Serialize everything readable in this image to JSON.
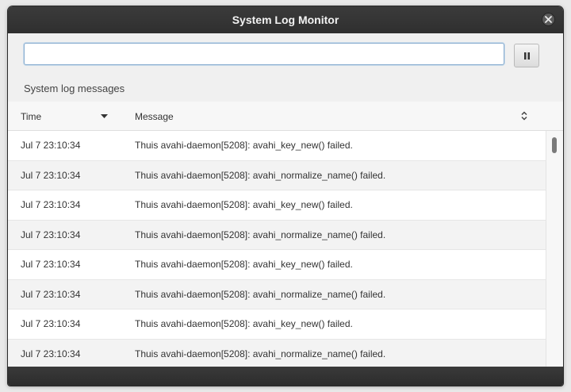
{
  "window": {
    "title": "System Log Monitor"
  },
  "toolbar": {
    "search_value": "",
    "pause_icon": "pause-icon"
  },
  "section": {
    "label": "System log messages"
  },
  "table": {
    "columns": {
      "time": "Time",
      "message": "Message"
    },
    "rows": [
      {
        "time": "Jul 7 23:10:34",
        "message": "Thuis avahi-daemon[5208]: avahi_key_new() failed."
      },
      {
        "time": "Jul 7 23:10:34",
        "message": "Thuis avahi-daemon[5208]: avahi_normalize_name() failed."
      },
      {
        "time": "Jul 7 23:10:34",
        "message": "Thuis avahi-daemon[5208]: avahi_key_new() failed."
      },
      {
        "time": "Jul 7 23:10:34",
        "message": "Thuis avahi-daemon[5208]: avahi_normalize_name() failed."
      },
      {
        "time": "Jul 7 23:10:34",
        "message": "Thuis avahi-daemon[5208]: avahi_key_new() failed."
      },
      {
        "time": "Jul 7 23:10:34",
        "message": "Thuis avahi-daemon[5208]: avahi_normalize_name() failed."
      },
      {
        "time": "Jul 7 23:10:34",
        "message": "Thuis avahi-daemon[5208]: avahi_key_new() failed."
      },
      {
        "time": "Jul 7 23:10:34",
        "message": "Thuis avahi-daemon[5208]: avahi_normalize_name() failed."
      }
    ]
  },
  "colors": {
    "titlebar": "#333333",
    "search_border": "#8aaed0",
    "row_alt": "#f3f3f3"
  }
}
